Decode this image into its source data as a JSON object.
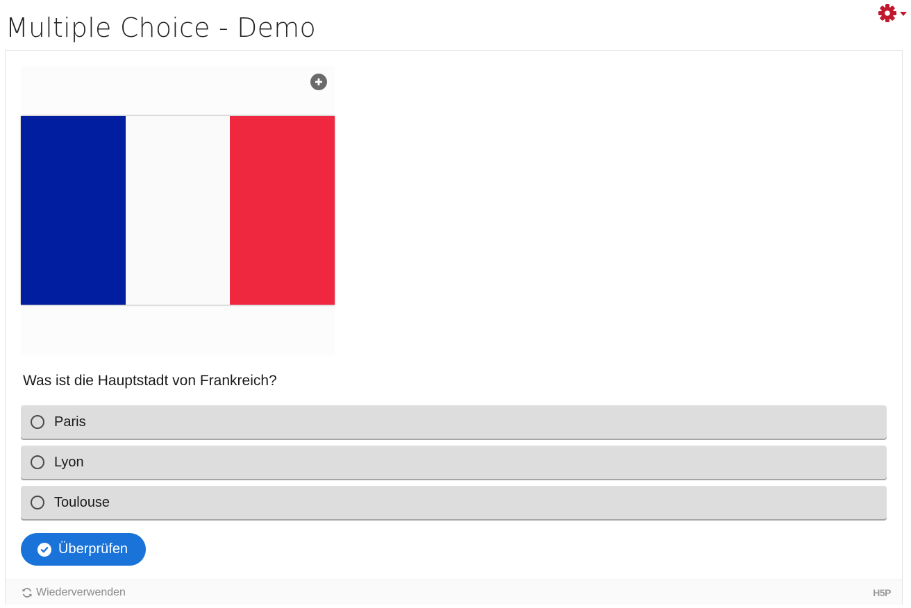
{
  "page": {
    "title": "Multiple Choice - Demo"
  },
  "header": {
    "settings_icon": "gear-icon",
    "settings_color": "#c0192e"
  },
  "media": {
    "image": "flag-of-france",
    "flag_colors": [
      "#001e9f",
      "#fafafa",
      "#f0283f"
    ],
    "expand_icon": "plus-circle-icon"
  },
  "question": {
    "text": "Was ist die Hauptstadt von Frankreich?"
  },
  "answers": [
    {
      "label": "Paris",
      "selected": false
    },
    {
      "label": "Lyon",
      "selected": false
    },
    {
      "label": "Toulouse",
      "selected": false
    }
  ],
  "buttons": {
    "check_label": "Überprüfen",
    "check_icon": "check-circle-icon",
    "accent": "#1a73d9"
  },
  "footer": {
    "reuse_label": "Wiederverwenden",
    "reuse_icon": "refresh-icon",
    "logo": "H5P"
  }
}
